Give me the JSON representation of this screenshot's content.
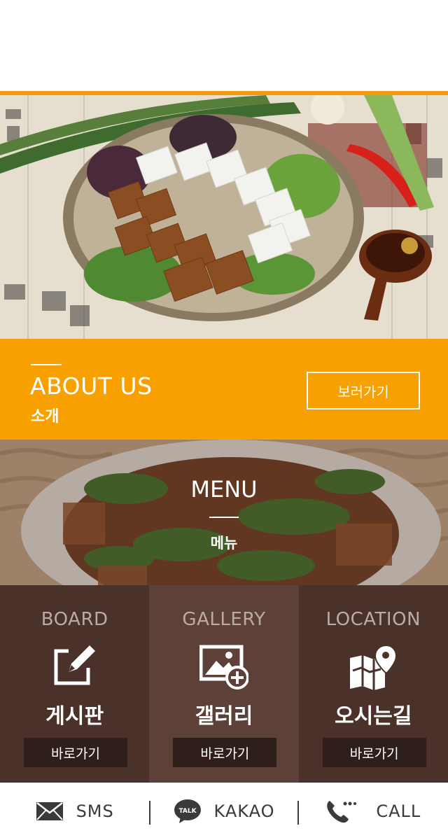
{
  "about": {
    "title_en": "ABOUT US",
    "title_ko": "소개",
    "button_label": "보러가기"
  },
  "menu": {
    "title_en": "MENU",
    "title_ko": "메뉴"
  },
  "tiles": [
    {
      "title_en": "BOARD",
      "title_ko": "게시판",
      "button_label": "바로가기",
      "icon": "edit-icon"
    },
    {
      "title_en": "GALLERY",
      "title_ko": "갤러리",
      "button_label": "바로가기",
      "icon": "gallery-add-icon"
    },
    {
      "title_en": "LOCATION",
      "title_ko": "오시는길",
      "button_label": "바로가기",
      "icon": "map-pin-icon"
    }
  ],
  "footer": {
    "sms_label": "SMS",
    "kakao_label": "KAKAO",
    "kakao_badge": "TALK",
    "call_label": "CALL"
  },
  "colors": {
    "accent": "#f7a000",
    "tile_dark": "#4a3129",
    "tile_mid": "#5d4037",
    "button_dark": "#2e1f1a"
  }
}
